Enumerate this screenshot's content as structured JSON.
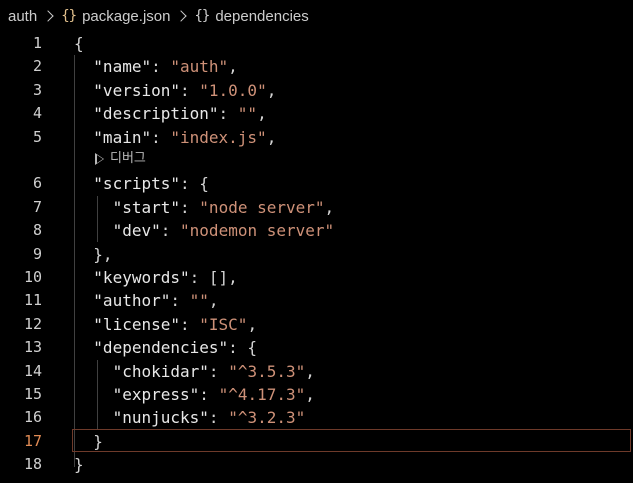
{
  "breadcrumb": {
    "folder": "auth",
    "file": "package.json",
    "file_icon": "json-braces-icon",
    "symbol": "dependencies",
    "symbol_icon": "object-braces-icon",
    "braces_text": "{}"
  },
  "codelens": {
    "label": "디버그",
    "icon": "play-icon"
  },
  "colors": {
    "background": "#000000",
    "string": "#ce9178",
    "key": "#e8e8e8",
    "active_line_number": "#e08b55",
    "json_icon": "#e2c08d"
  },
  "editor": {
    "active_line": 17,
    "lines": [
      {
        "num": "1",
        "tokens": [
          {
            "t": "punc",
            "v": "{"
          }
        ]
      },
      {
        "num": "2",
        "tokens": [
          {
            "t": "key",
            "v": "\"name\""
          },
          {
            "t": "punc",
            "v": ": "
          },
          {
            "t": "str",
            "v": "\"auth\""
          },
          {
            "t": "punc",
            "v": ","
          }
        ]
      },
      {
        "num": "3",
        "tokens": [
          {
            "t": "key",
            "v": "\"version\""
          },
          {
            "t": "punc",
            "v": ": "
          },
          {
            "t": "str",
            "v": "\"1.0.0\""
          },
          {
            "t": "punc",
            "v": ","
          }
        ]
      },
      {
        "num": "4",
        "tokens": [
          {
            "t": "key",
            "v": "\"description\""
          },
          {
            "t": "punc",
            "v": ": "
          },
          {
            "t": "str",
            "v": "\"\""
          },
          {
            "t": "punc",
            "v": ","
          }
        ]
      },
      {
        "num": "5",
        "tokens": [
          {
            "t": "key",
            "v": "\"main\""
          },
          {
            "t": "punc",
            "v": ": "
          },
          {
            "t": "str",
            "v": "\"index.js\""
          },
          {
            "t": "punc",
            "v": ","
          }
        ]
      },
      {
        "num": "6",
        "tokens": [
          {
            "t": "key",
            "v": "\"scripts\""
          },
          {
            "t": "punc",
            "v": ": {"
          }
        ]
      },
      {
        "num": "7",
        "tokens": [
          {
            "t": "key",
            "v": "\"start\""
          },
          {
            "t": "punc",
            "v": ": "
          },
          {
            "t": "str",
            "v": "\"node server\""
          },
          {
            "t": "punc",
            "v": ","
          }
        ]
      },
      {
        "num": "8",
        "tokens": [
          {
            "t": "key",
            "v": "\"dev\""
          },
          {
            "t": "punc",
            "v": ": "
          },
          {
            "t": "str",
            "v": "\"nodemon server\""
          }
        ]
      },
      {
        "num": "9",
        "tokens": [
          {
            "t": "punc",
            "v": "},"
          }
        ]
      },
      {
        "num": "10",
        "tokens": [
          {
            "t": "key",
            "v": "\"keywords\""
          },
          {
            "t": "punc",
            "v": ": [],"
          }
        ]
      },
      {
        "num": "11",
        "tokens": [
          {
            "t": "key",
            "v": "\"author\""
          },
          {
            "t": "punc",
            "v": ": "
          },
          {
            "t": "str",
            "v": "\"\""
          },
          {
            "t": "punc",
            "v": ","
          }
        ]
      },
      {
        "num": "12",
        "tokens": [
          {
            "t": "key",
            "v": "\"license\""
          },
          {
            "t": "punc",
            "v": ": "
          },
          {
            "t": "str",
            "v": "\"ISC\""
          },
          {
            "t": "punc",
            "v": ","
          }
        ]
      },
      {
        "num": "13",
        "tokens": [
          {
            "t": "key",
            "v": "\"dependencies\""
          },
          {
            "t": "punc",
            "v": ": {"
          }
        ]
      },
      {
        "num": "14",
        "tokens": [
          {
            "t": "key",
            "v": "\"chokidar\""
          },
          {
            "t": "punc",
            "v": ": "
          },
          {
            "t": "str",
            "v": "\"^3.5.3\""
          },
          {
            "t": "punc",
            "v": ","
          }
        ]
      },
      {
        "num": "15",
        "tokens": [
          {
            "t": "key",
            "v": "\"express\""
          },
          {
            "t": "punc",
            "v": ": "
          },
          {
            "t": "str",
            "v": "\"^4.17.3\""
          },
          {
            "t": "punc",
            "v": ","
          }
        ]
      },
      {
        "num": "16",
        "tokens": [
          {
            "t": "key",
            "v": "\"nunjucks\""
          },
          {
            "t": "punc",
            "v": ": "
          },
          {
            "t": "str",
            "v": "\"^3.2.3\""
          }
        ]
      },
      {
        "num": "17",
        "tokens": [
          {
            "t": "punc",
            "v": "}"
          }
        ]
      },
      {
        "num": "18",
        "tokens": [
          {
            "t": "punc",
            "v": "}"
          }
        ]
      }
    ]
  }
}
